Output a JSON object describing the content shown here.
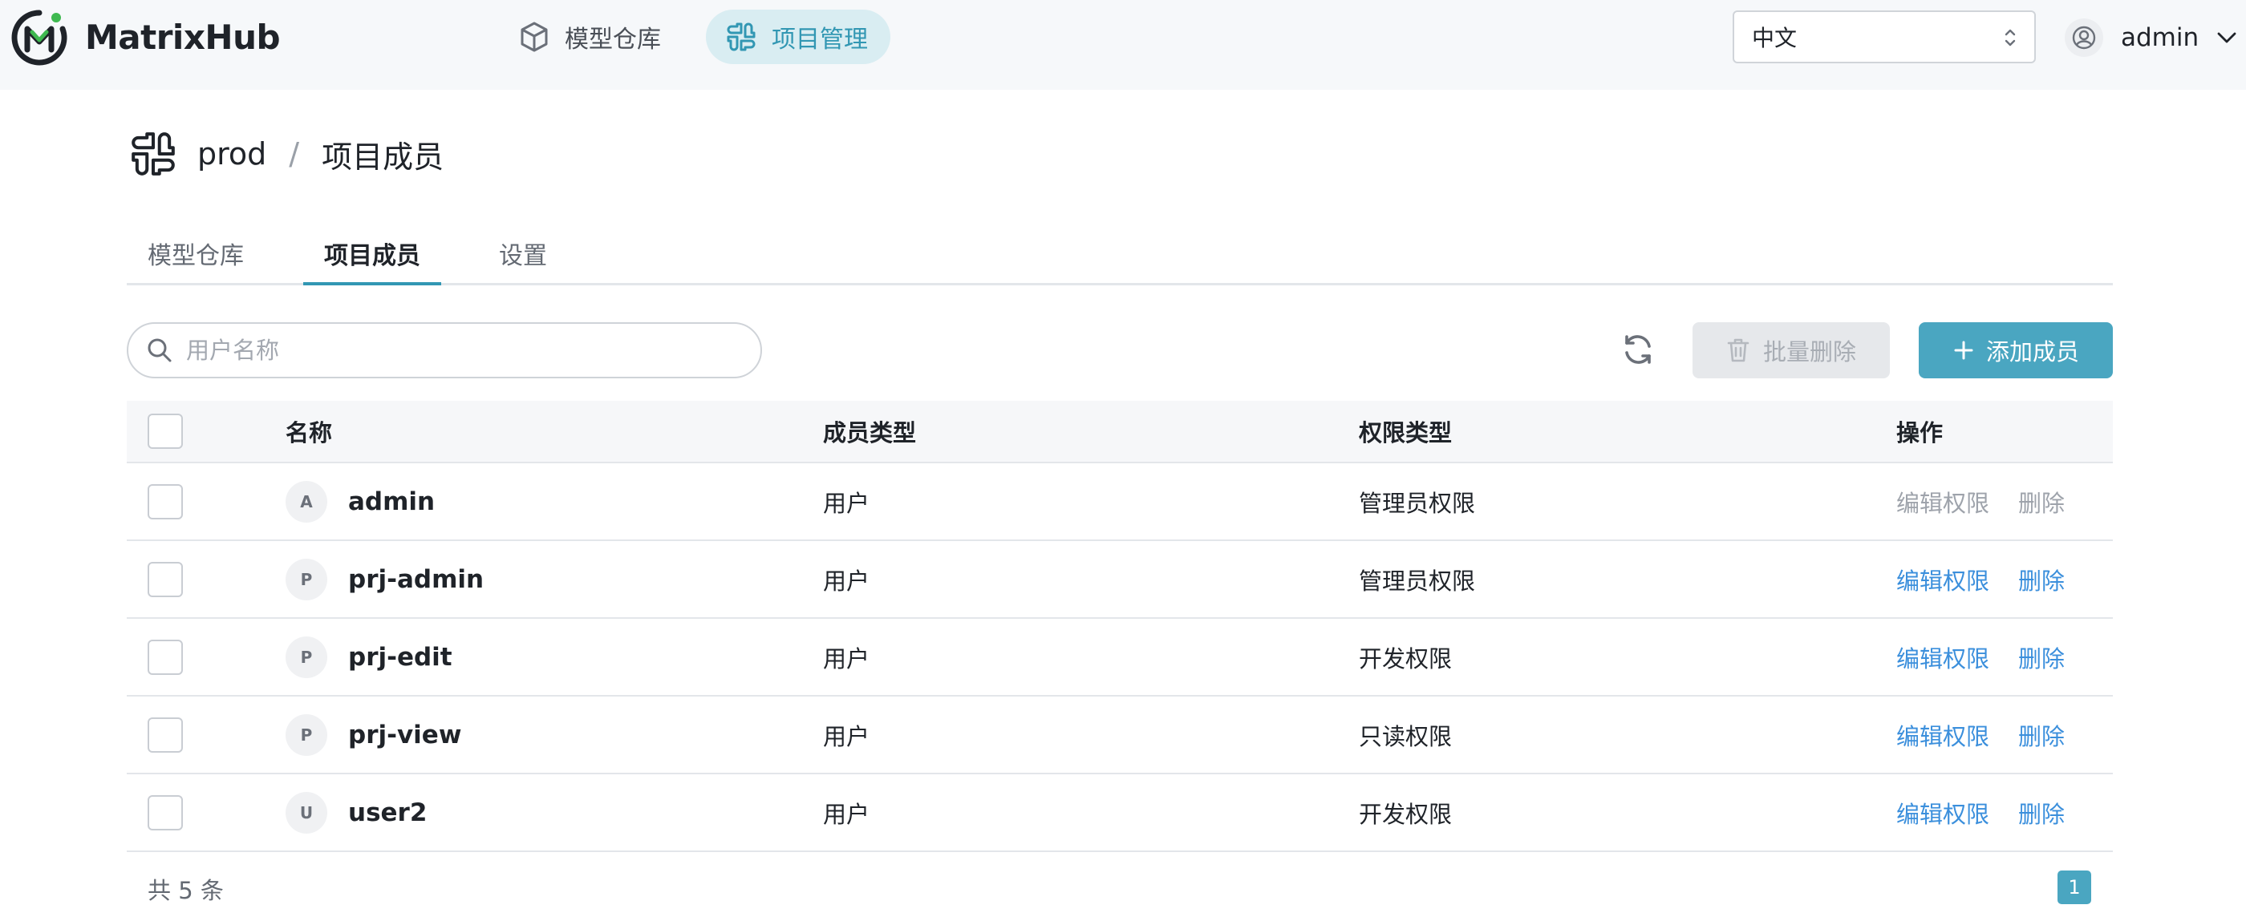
{
  "app": {
    "brand": "MatrixHub",
    "accent": "#4aa6c1"
  },
  "nav": {
    "items": [
      {
        "label": "模型仓库",
        "icon": "cube-icon",
        "active": false
      },
      {
        "label": "项目管理",
        "icon": "project-icon",
        "active": true
      }
    ],
    "language": "中文",
    "user": "admin"
  },
  "breadcrumb": {
    "project": "prod",
    "separator": "/",
    "page": "项目成员"
  },
  "tabs": [
    {
      "label": "模型仓库",
      "active": false
    },
    {
      "label": "项目成员",
      "active": true
    },
    {
      "label": "设置",
      "active": false
    }
  ],
  "toolbar": {
    "search_placeholder": "用户名称",
    "batch_delete_label": "批量删除",
    "add_member_label": "添加成员"
  },
  "table": {
    "headers": {
      "name": "名称",
      "member_type": "成员类型",
      "permission": "权限类型",
      "actions": "操作"
    },
    "rows": [
      {
        "initial": "A",
        "name": "admin",
        "member_type": "用户",
        "permission": "管理员权限",
        "edit": "编辑权限",
        "delete": "删除",
        "ops_enabled": false
      },
      {
        "initial": "P",
        "name": "prj-admin",
        "member_type": "用户",
        "permission": "管理员权限",
        "edit": "编辑权限",
        "delete": "删除",
        "ops_enabled": true
      },
      {
        "initial": "P",
        "name": "prj-edit",
        "member_type": "用户",
        "permission": "开发权限",
        "edit": "编辑权限",
        "delete": "删除",
        "ops_enabled": true
      },
      {
        "initial": "P",
        "name": "prj-view",
        "member_type": "用户",
        "permission": "只读权限",
        "edit": "编辑权限",
        "delete": "删除",
        "ops_enabled": true
      },
      {
        "initial": "U",
        "name": "user2",
        "member_type": "用户",
        "permission": "开发权限",
        "edit": "编辑权限",
        "delete": "删除",
        "ops_enabled": true
      }
    ]
  },
  "pagination": {
    "total_text": "共 5 条",
    "current_page": "1"
  }
}
